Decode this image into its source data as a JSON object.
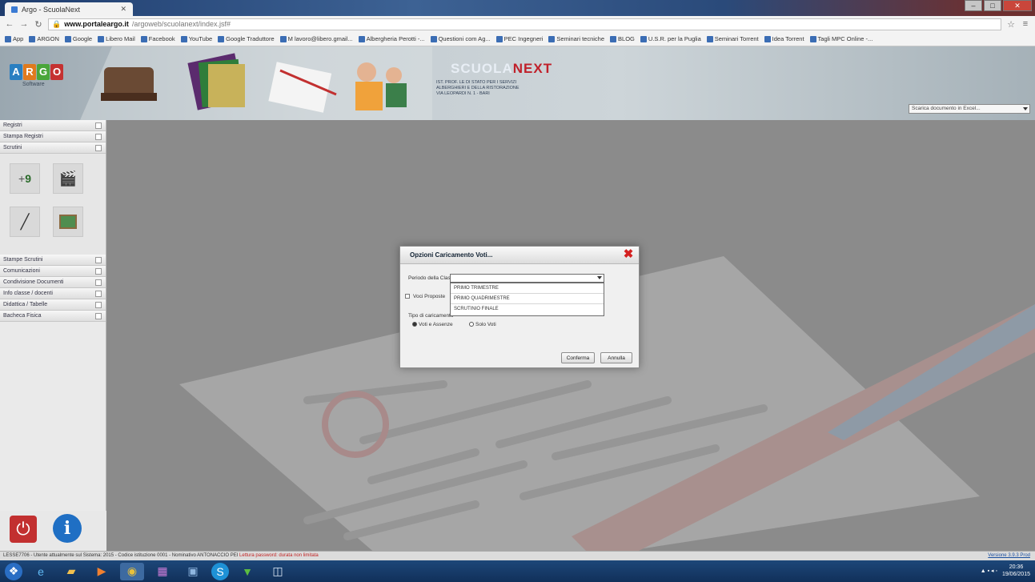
{
  "browser": {
    "tab_title": "Argo - ScuolaNext",
    "address_host": "www.portaleargo.it",
    "address_path": "/argoweb/scuolanext/index.jsf#",
    "bookmarks": [
      "App",
      "ARGON",
      "Google",
      "Libero Mail",
      "Facebook",
      "YouTube",
      "Google Traduttore",
      "M lavoro@libero.gmail...",
      "Albergheria Perotti -...",
      "Questioni com Ag...",
      "PEC Ingegneri",
      "Seminari tecniche",
      "BLOG",
      "U.S.R. per la Puglia",
      "Seminari Torrent",
      "Idea Torrent",
      "Tagli MPC Online -..."
    ]
  },
  "header": {
    "logo_letters": [
      "A",
      "R",
      "G",
      "O"
    ],
    "logo_subtitle": "Software",
    "brand_prefix": "SCUOLA",
    "brand_suffix": "NEXT",
    "brand_lines": [
      "IST. PROF. LE DI STATO PER I SERVIZI",
      "ALBERGHIERI E DELLA RISTORAZIONE",
      "VIA LEOPARDI N. 1 - BARI"
    ],
    "select_value": "Scarica documento in Excel..."
  },
  "sidebar": {
    "top_items": [
      "Registri",
      "Stampa Registri",
      "Scrutini"
    ],
    "bottom_items": [
      "Stampe Scrutini",
      "Comunicazioni",
      "Condivisione Documenti",
      "Info classe / docenti",
      "Didattica / Tabelle",
      "Bacheca Fisica"
    ]
  },
  "dialog": {
    "title": "Opzioni Caricamento Voti...",
    "period_label": "Periodo della Classe",
    "period_value": "",
    "period_options": [
      "PRIMO TRIMESTRE",
      "PRIMO QUADRIMESTRE",
      "SCRUTINIO FINALE"
    ],
    "proposal_label": "Voci Proposte",
    "type_label": "Tipo di caricamento",
    "radio_1": "Voti e Assenze",
    "radio_2": "Solo Voti",
    "confirm_label": "Conferma",
    "cancel_label": "Annulla"
  },
  "statusbar": {
    "text": "LESSE7706 - Utente attualmente sul Sistema: 2015 - Codice istituzione 0001 - Nominativo ANTONACCIO PEI",
    "warning": "Lettura password: durata non limitata",
    "version": "Versione 3.9.3 Prod"
  },
  "taskbar": {
    "time": "20:36",
    "date": "19/06/2015"
  }
}
